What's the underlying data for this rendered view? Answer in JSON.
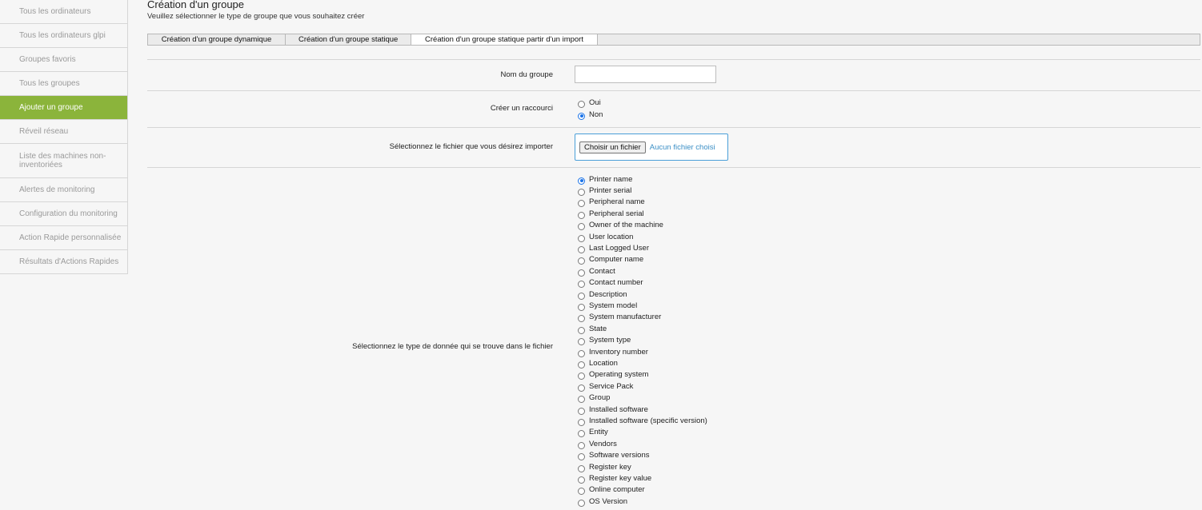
{
  "sidebar": {
    "items": [
      {
        "label": "Tous les ordinateurs"
      },
      {
        "label": "Tous les ordinateurs glpi"
      },
      {
        "label": "Groupes favoris"
      },
      {
        "label": "Tous les groupes"
      },
      {
        "label": "Ajouter un groupe"
      },
      {
        "label": "Réveil réseau"
      },
      {
        "label": "Liste des machines non-inventoriées"
      },
      {
        "label": "Alertes de monitoring"
      },
      {
        "label": "Configuration du monitoring"
      },
      {
        "label": "Action Rapide personnalisée"
      },
      {
        "label": "Résultats d'Actions Rapides"
      }
    ],
    "active_color": "#8bb43b"
  },
  "header": {
    "title": "Création d'un groupe",
    "subtitle": "Veuillez sélectionner le type de groupe que vous souhaitez créer"
  },
  "tabs": [
    {
      "label": "Création d'un groupe dynamique"
    },
    {
      "label": "Création d'un groupe statique"
    },
    {
      "label": "Création d'un groupe statique partir d'un import"
    }
  ],
  "form": {
    "group_name_label": "Nom du groupe",
    "group_name_value": "",
    "shortcut_label": "Créer un raccourci",
    "shortcut_options": [
      "Oui",
      "Non"
    ],
    "shortcut_selected": "Non",
    "file_label": "Sélectionnez le fichier que vous désirez importer",
    "file_button": "Choisir un fichier",
    "file_status": "Aucun fichier choisi",
    "datatype_label": "Sélectionnez le type de donnée qui se trouve dans le fichier",
    "datatype_selected": "Printer name",
    "datatype_options": [
      "Printer name",
      "Printer serial",
      "Peripheral name",
      "Peripheral serial",
      "Owner of the machine",
      "User location",
      "Last Logged User",
      "Computer name",
      "Contact",
      "Contact number",
      "Description",
      "System model",
      "System manufacturer",
      "State",
      "System type",
      "Inventory number",
      "Location",
      "Operating system",
      "Service Pack",
      "Group",
      "Installed software",
      "Installed software (specific version)",
      "Entity",
      "Vendors",
      "Software versions",
      "Register key",
      "Register key value",
      "Online computer",
      "OS Version"
    ]
  }
}
